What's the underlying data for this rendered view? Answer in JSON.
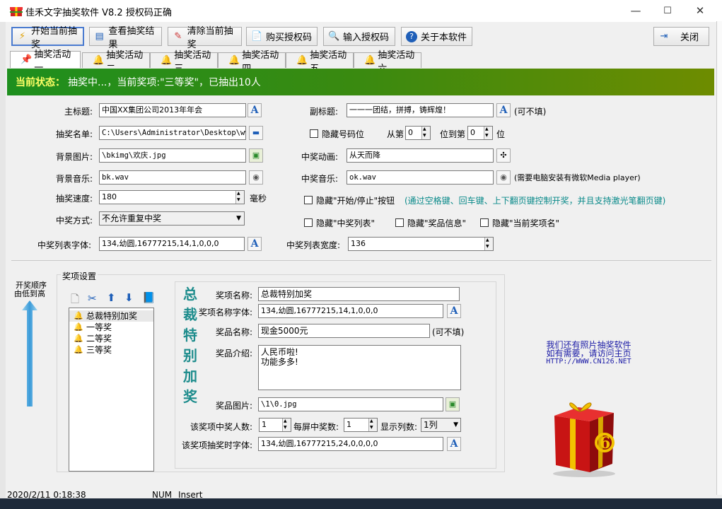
{
  "window": {
    "title": "佳禾文字抽奖软件 V8.2 授权码正确",
    "min": "—",
    "max": "☐",
    "close": "✕"
  },
  "toolbar": {
    "start": "开始当前抽奖",
    "view": "查看抽奖结果",
    "clear": "清除当前抽奖",
    "buy": "购买授权码",
    "enter": "输入授权码",
    "about": "关于本软件",
    "close": "关闭"
  },
  "tabs": [
    "抽奖活动一",
    "抽奖活动二",
    "抽奖活动三",
    "抽奖活动四",
    "抽奖活动五",
    "抽奖活动六"
  ],
  "banner": {
    "label": "当前状态：",
    "text": "抽奖中...，当前奖项:\"三等奖\"，已抽出10人"
  },
  "form": {
    "main_title_label": "主标题:",
    "main_title": "中国XX集团公司2013年年会",
    "sub_title_label": "副标题:",
    "sub_title": "一一一团结，拼搏，铸辉煌！",
    "sub_title_note": "(可不填)",
    "list_label": "抽奖名单:",
    "list_value": "C:\\Users\\Administrator\\Desktop\\www",
    "hide_number_label": "隐藏号码位",
    "from_label": "从第",
    "from_value": "0",
    "to_label": "位到第",
    "to_value": "0",
    "unit_wei": "位",
    "bg_image_label": "背景图片:",
    "bg_image": "\\bkimg\\欢庆.jpg",
    "anim_label": "中奖动画:",
    "anim_value": "从天而降",
    "bg_music_label": "背景音乐:",
    "bg_music": "bk.wav",
    "win_music_label": "中奖音乐:",
    "win_music": "ok.wav",
    "win_music_note": "(需要电脑安装有微软Media player)",
    "speed_label": "抽奖速度:",
    "speed_value": "180",
    "speed_unit": "毫秒",
    "hide_button_label": "隐藏\"开始/停止\"按钮",
    "hide_button_hint": "(通过空格键、回车键、上下翻页键控制开奖，并且支持激光笔翻页键)",
    "mode_label": "中奖方式:",
    "mode_value": "不允许重复中奖",
    "hide_list_label": "隐藏\"中奖列表\"",
    "hide_prize_info_label": "隐藏\"奖品信息\"",
    "hide_current_label": "隐藏\"当前奖项名\"",
    "list_font_label": "中奖列表字体:",
    "list_font_value": "134,幼圆,16777215,14,1,0,0,0",
    "list_width_label": "中奖列表宽度:",
    "list_width_value": "136"
  },
  "order": {
    "line1": "开奖顺序",
    "line2": "由低到高"
  },
  "prize_settings": {
    "group_label": "奖项设置",
    "items": [
      "总裁特别加奖",
      "一等奖",
      "二等奖",
      "三等奖"
    ],
    "big_title": [
      "总",
      "裁",
      "特",
      "别",
      "加",
      "奖"
    ],
    "name_label": "奖项名称:",
    "name_value": "总裁特别加奖",
    "name_font_label": "奖项名称字体:",
    "name_font_value": "134,幼圆,16777215,14,1,0,0,0",
    "prize_label": "奖品名称:",
    "prize_value": "现金5000元",
    "prize_note": "(可不填)",
    "intro_label": "奖品介绍:",
    "intro_line1": "人民币啦!",
    "intro_line2": "功能多多!",
    "image_label": "奖品图片:",
    "image_value": "\\1\\0.jpg",
    "count_label": "该奖项中奖人数:",
    "count_value": "1",
    "per_screen_label": "每屏中奖数:",
    "per_screen_value": "1",
    "columns_label": "显示列数:",
    "columns_value": "1列",
    "draw_font_label": "该奖项抽奖时字体:",
    "draw_font_value": "134,幼圆,16777215,24,0,0,0,0"
  },
  "promo": {
    "line1": "我们还有照片抽奖软件",
    "line2": "如有需要，请访问主页",
    "line3": "HTTP://WWW.CN126.NET"
  },
  "status": {
    "datetime": "2020/2/11  0:18:38",
    "num": "NUM",
    "insert": "Insert"
  },
  "colors": {
    "banner_start": "#1e8f1e",
    "banner_end": "#6e8c00",
    "hint": "#0a8a8a",
    "link": "#1a1aa6",
    "title_teal": "#1d8c8c"
  }
}
